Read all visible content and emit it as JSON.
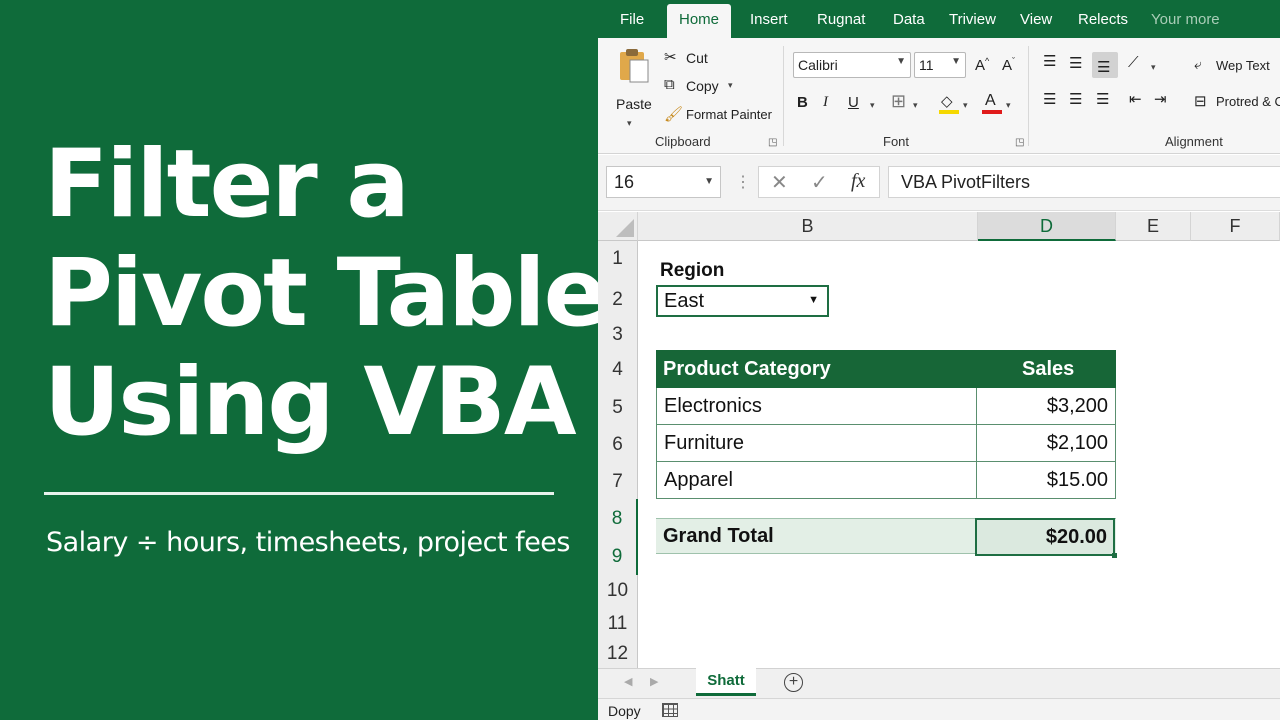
{
  "headline": {
    "line1": "Filter a",
    "line2": "Pivot Table",
    "line3": "Using VBA",
    "subtitle": "Salary ÷ hours, timesheets, project fees"
  },
  "menu": {
    "tabs": [
      "File",
      "Home",
      "Insert",
      "Rugnat",
      "Data",
      "Triview",
      "View",
      "Relects",
      "Your more"
    ],
    "active": "Home"
  },
  "ribbon": {
    "clipboard": {
      "paste": "Paste",
      "cut": "Cut",
      "copy": "Copy",
      "format_painter": "Format Painter",
      "group_label": "Clipboard"
    },
    "font": {
      "font_name": "Calibri",
      "font_size": "11",
      "bold": "B",
      "italic": "I",
      "underline": "U",
      "group_label": "Font"
    },
    "alignment": {
      "wrap_text": "Wep Text",
      "protect": "Protred & C",
      "group_label": "Alignment"
    }
  },
  "formula_bar": {
    "name_box": "16",
    "fx": "fx",
    "content": "VBA PivotFilters"
  },
  "columns": [
    "B",
    "D",
    "E",
    "F"
  ],
  "selected_column": "D",
  "rows": [
    "1",
    "2",
    "3",
    "4",
    "5",
    "6",
    "7",
    "8",
    "9",
    "10",
    "11",
    "12"
  ],
  "filter": {
    "label": "Region",
    "value": "East"
  },
  "pivot": {
    "headers": [
      "Product Category",
      "Sales"
    ],
    "rows": [
      {
        "category": "Electronics",
        "sales": "$3,200"
      },
      {
        "category": "Furniture",
        "sales": "$2,100"
      },
      {
        "category": "Apparel",
        "sales": "$15.00"
      }
    ],
    "total_label": "Grand Total",
    "total_value": "$20.00"
  },
  "sheet_tab": "Shatt",
  "status": "Dopy",
  "colors": {
    "brand_green": "#0f6b3a",
    "header_green": "#176637",
    "total_fill": "#e3efe6"
  }
}
